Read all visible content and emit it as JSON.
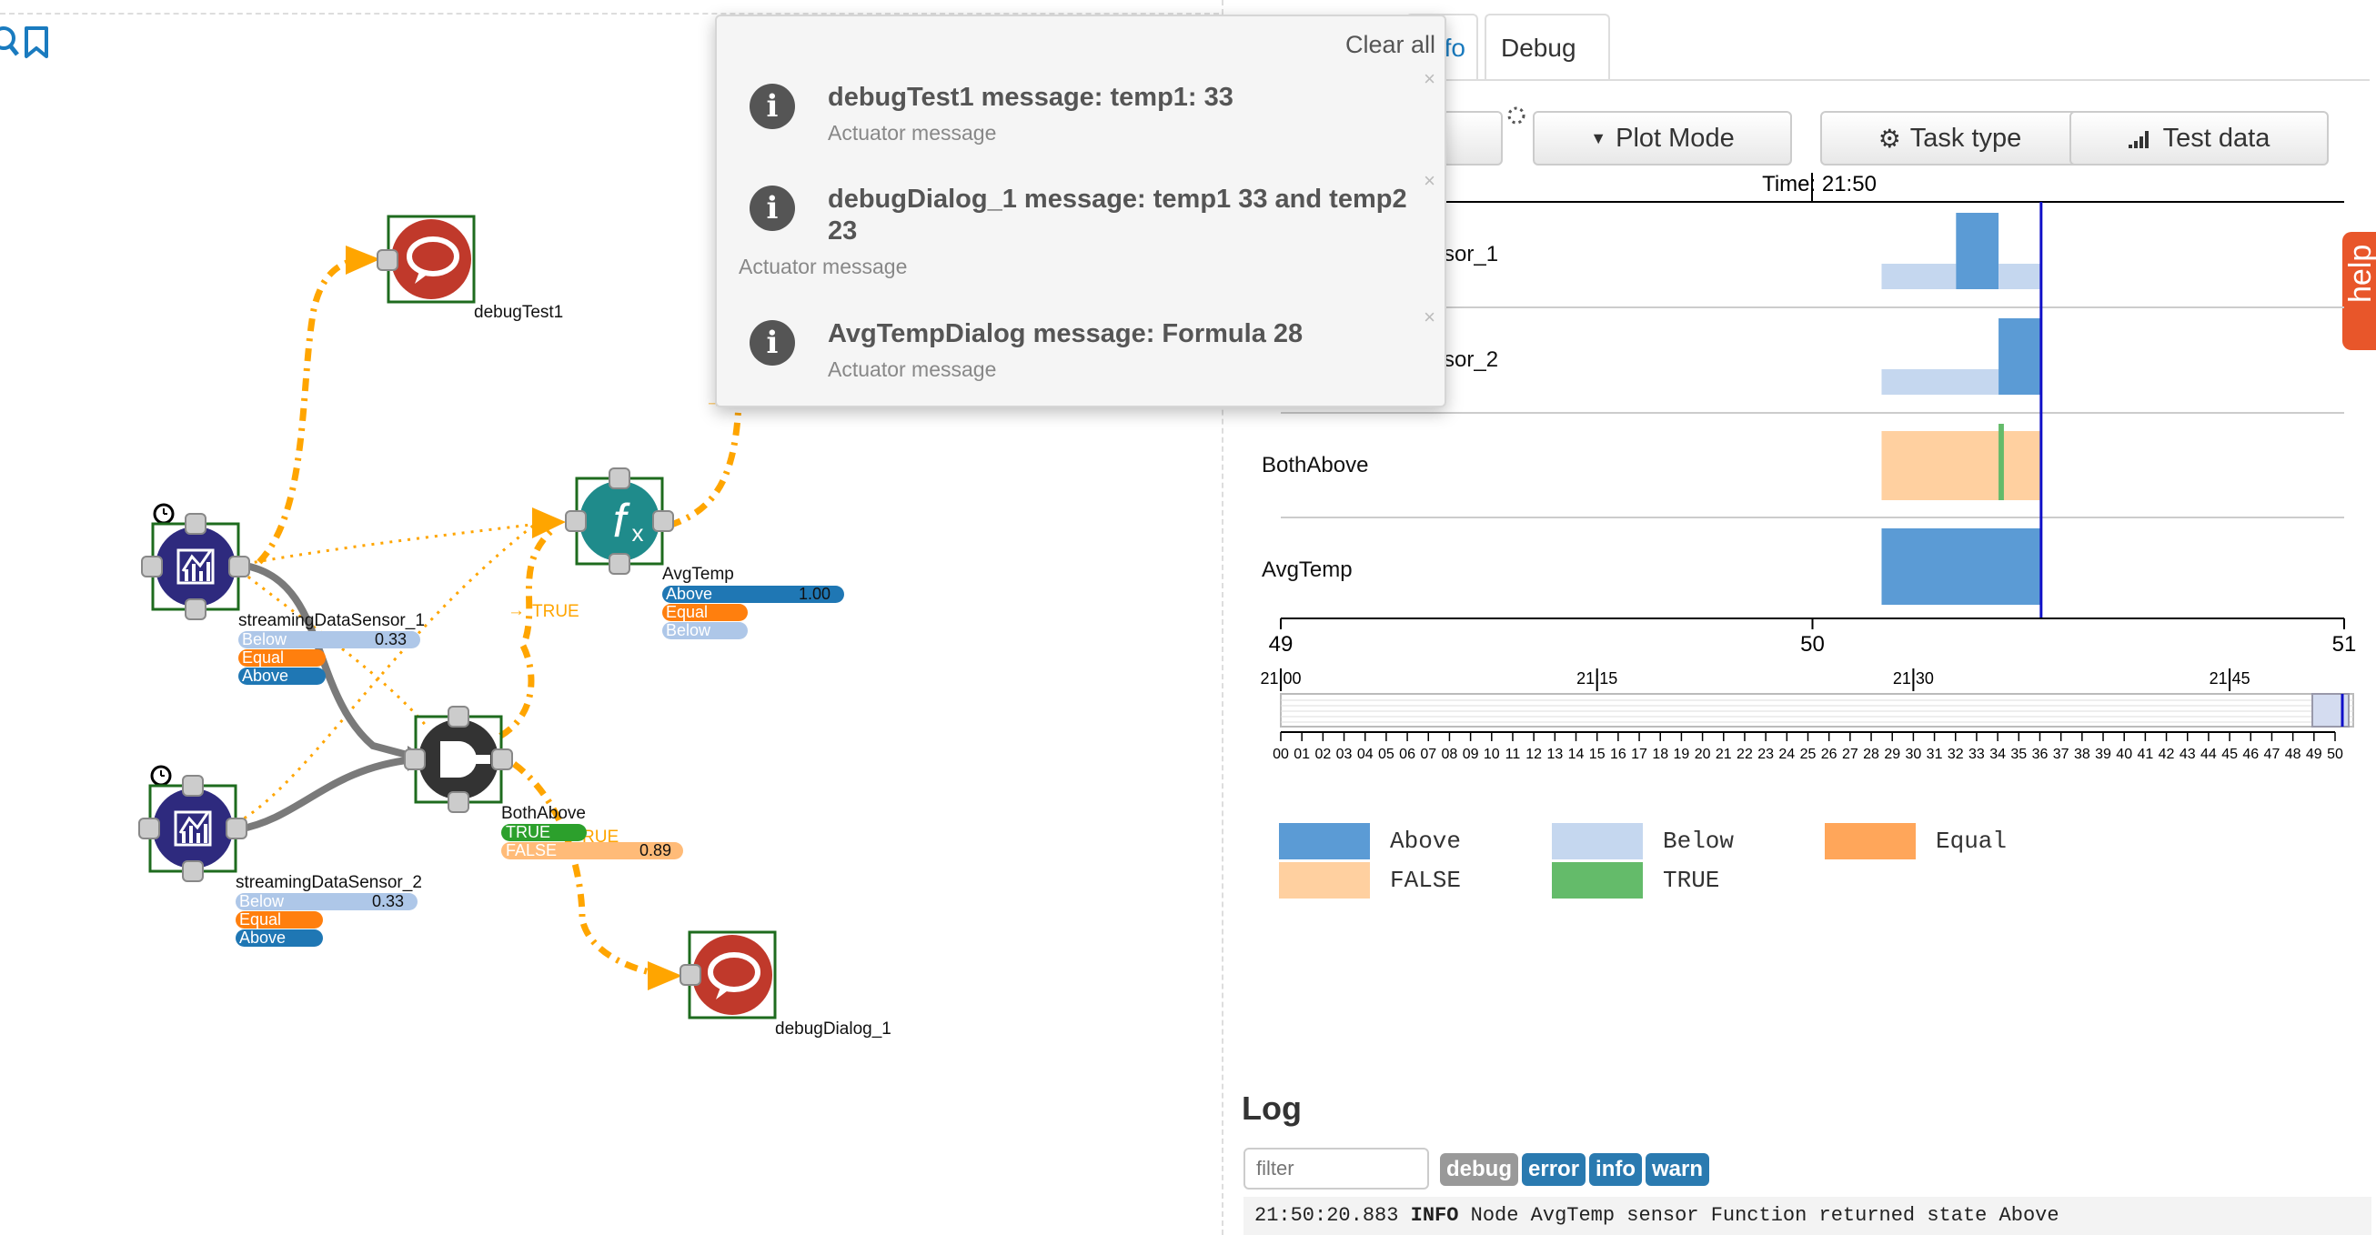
{
  "toolbar": {
    "search_icon": "search-icon",
    "bookmark_icon": "bookmark-icon"
  },
  "canvas": {
    "nodes": {
      "debugTest1": "debugTest1",
      "avgTemp": "AvgTemp",
      "sensor1": "streamingDataSensor_1",
      "sensor2": "streamingDataSensor_2",
      "bothAbove": "BothAbove",
      "debugDialog": "debugDialog_1"
    },
    "edge_labels": {
      "above": "Above",
      "true": "TRUE",
      "arrow_prefix": "→",
      "rue": "RUE"
    },
    "state_bars": {
      "sensor1": {
        "below": "Below",
        "below_value": "0.33",
        "equal": "Equal",
        "above": "Above"
      },
      "sensor2": {
        "below": "Below",
        "below_value": "0.33",
        "equal": "Equal",
        "above": "Above"
      },
      "avgTemp": {
        "above": "Above",
        "above_value": "1.00",
        "equal": "Equal",
        "below": "Below"
      },
      "bothAbove": {
        "true": "TRUE",
        "false": "FALSE",
        "false_value": "0.89"
      }
    },
    "colors": {
      "above": "#1f77b4",
      "equal": "#ff7f0e",
      "below": "#aec7e8",
      "true": "#2ca02c",
      "false": "#ffbb78",
      "debug_node": "#c0392b",
      "sensor_node": "#2e2a7e",
      "function_node": "#1f8b8b",
      "gate_node": "#333333",
      "edge": "#ffa500"
    }
  },
  "notifications": {
    "clear_all": "Clear all",
    "items": [
      {
        "title": "debugTest1 message: temp1: 33",
        "subtitle": "Actuator message"
      },
      {
        "title": "debugDialog_1 message: temp1 33 and temp2 23",
        "subtitle": "Actuator message"
      },
      {
        "title": "AvgTempDialog message: Formula 28",
        "subtitle": "Actuator message"
      }
    ],
    "close_glyph": "×"
  },
  "right_panel": {
    "tabs": {
      "info": "fo",
      "debug": "Debug"
    },
    "buttons": {
      "plot_mode": "Plot Mode",
      "task_type": "Task type",
      "test_data": "Test data"
    },
    "help_label": "help"
  },
  "chart_data": {
    "type": "timeline",
    "title": "Time: 21:50",
    "rows": [
      "streamingDataSensor_1",
      "streamingDataSensor_2",
      "BothAbove",
      "AvgTemp"
    ],
    "row_labels_visible": [
      "sor_1",
      "sor_2",
      "BothAbove",
      "AvgTemp"
    ],
    "x_axis": {
      "ticks": [
        "49",
        "50",
        "51"
      ],
      "range": [
        49,
        51
      ]
    },
    "current_time_marker": 50.43,
    "overview_ticks_major": [
      "21:00",
      "21:15",
      "21:30",
      "21:45"
    ],
    "overview_ticks_minor": [
      "00",
      "01",
      "02",
      "03",
      "04",
      "05",
      "06",
      "07",
      "08",
      "09",
      "10",
      "11",
      "12",
      "13",
      "14",
      "15",
      "16",
      "17",
      "18",
      "19",
      "20",
      "21",
      "22",
      "23",
      "24",
      "25",
      "26",
      "27",
      "28",
      "29",
      "30",
      "31",
      "32",
      "33",
      "34",
      "35",
      "36",
      "37",
      "38",
      "39",
      "40",
      "41",
      "42",
      "43",
      "44",
      "45",
      "46",
      "47",
      "48",
      "49",
      "50"
    ],
    "segments": [
      {
        "row": "streamingDataSensor_1",
        "state": "Below",
        "start": 50.13,
        "end": 50.27
      },
      {
        "row": "streamingDataSensor_1",
        "state": "Above",
        "start": 50.27,
        "end": 50.35
      },
      {
        "row": "streamingDataSensor_1",
        "state": "Below",
        "start": 50.35,
        "end": 50.43
      },
      {
        "row": "streamingDataSensor_2",
        "state": "Below",
        "start": 50.13,
        "end": 50.35
      },
      {
        "row": "streamingDataSensor_2",
        "state": "Above",
        "start": 50.35,
        "end": 50.43
      },
      {
        "row": "BothAbove",
        "state": "FALSE",
        "start": 50.13,
        "end": 50.43
      },
      {
        "row": "BothAbove",
        "state": "TRUE",
        "start": 50.35,
        "end": 50.36
      },
      {
        "row": "AvgTemp",
        "state": "Above",
        "start": 50.13,
        "end": 50.43
      }
    ],
    "legend": [
      "Above",
      "Below",
      "Equal",
      "FALSE",
      "TRUE"
    ],
    "legend_colors": {
      "Above": "#5b9bd5",
      "Below": "#c5d7ef",
      "Equal": "#ffa65a",
      "FALSE": "#ffd0a0",
      "TRUE": "#64bb6a"
    }
  },
  "log": {
    "title": "Log",
    "filter_placeholder": "filter",
    "badges": [
      "debug",
      "error",
      "info",
      "warn"
    ],
    "badge_colors": [
      "#999999",
      "#2a7ab0",
      "#2a7ab0",
      "#2a7ab0"
    ],
    "entry": {
      "time": "21:50:20.883",
      "level": "INFO",
      "message": "Node AvgTemp sensor Function returned state Above"
    }
  }
}
